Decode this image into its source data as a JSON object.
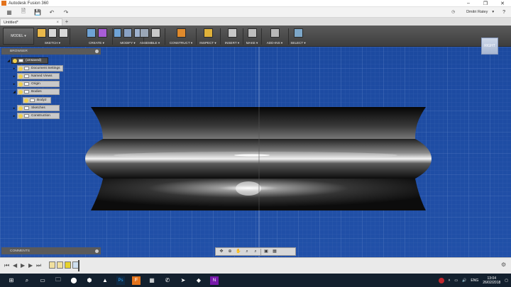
{
  "window": {
    "title": "Autodesk Fusion 360",
    "controls": [
      "–",
      "❐",
      "✕"
    ]
  },
  "user": {
    "name": "Dmitri Ratey",
    "chevron": "▾",
    "help": "?"
  },
  "tab": {
    "label": "Untitled*",
    "close": "×",
    "add": "+"
  },
  "workspace": {
    "label": "MODEL ▾"
  },
  "ribbon": [
    {
      "label": "SKETCH ▾",
      "colors": [
        "#e9b84a",
        "#d8d8d8",
        "#d8d8d8"
      ]
    },
    {
      "label": "CREATE ▾",
      "colors": [
        "#6fa3d6",
        "#a85dd6"
      ]
    },
    {
      "label": "MODIFY ▾",
      "colors": [
        "#6fa3d6",
        "#8aa2c4",
        "#9fb2cf"
      ]
    },
    {
      "label": "ASSEMBLE ▾",
      "colors": [
        "#9aa6b6",
        "#c8c8c8"
      ]
    },
    {
      "label": "CONSTRUCT ▾",
      "colors": [
        "#e08a2c"
      ]
    },
    {
      "label": "INSPECT ▾",
      "colors": [
        "#e0b23a"
      ]
    },
    {
      "label": "INSERT ▾",
      "colors": [
        "#c7c7c7"
      ]
    },
    {
      "label": "MAKE ▾",
      "colors": [
        "#bdbdbd"
      ]
    },
    {
      "label": "ADD-INS ▾",
      "colors": [
        "#b8b8b8"
      ]
    },
    {
      "label": "SELECT ▾",
      "colors": [
        "#7da7c9"
      ]
    }
  ],
  "viewcube": {
    "label": "RIGHT"
  },
  "browser": {
    "title": "BROWSER",
    "nodes": [
      {
        "label": "(Unsaved)",
        "expander": "◢"
      },
      {
        "label": "Document Settings",
        "expander": "▸"
      },
      {
        "label": "Named Views",
        "expander": "▸"
      },
      {
        "label": "Origin",
        "expander": "▸"
      },
      {
        "label": "Bodies",
        "expander": "◢"
      },
      {
        "label": "Body2",
        "expander": ""
      },
      {
        "label": "Sketches",
        "expander": "▸"
      },
      {
        "label": "Construction",
        "expander": "▸"
      }
    ]
  },
  "comments": {
    "title": "COMMENTS"
  },
  "navbar": {
    "icons": [
      "✥",
      "⊕",
      "✋",
      "⌕",
      "⌕",
      "▣",
      "▦"
    ]
  },
  "timeline": {
    "buttons": [
      "⏮",
      "◀",
      "▶",
      "▶",
      "⏭"
    ],
    "settings": "⚙"
  },
  "taskbar": {
    "apps": [
      "⊞",
      "⌕",
      "▭",
      "🗀",
      "⬤",
      "⬢",
      "▲",
      "Ps",
      "F",
      "▦",
      "✆",
      "➤",
      "◆",
      "N"
    ],
    "tray": {
      "language": "ENG",
      "time": "13:04",
      "date": "26/02/2018"
    }
  },
  "colors": {
    "viewport_blue": "#1f4fa8",
    "accent_orange": "#e3731c"
  }
}
